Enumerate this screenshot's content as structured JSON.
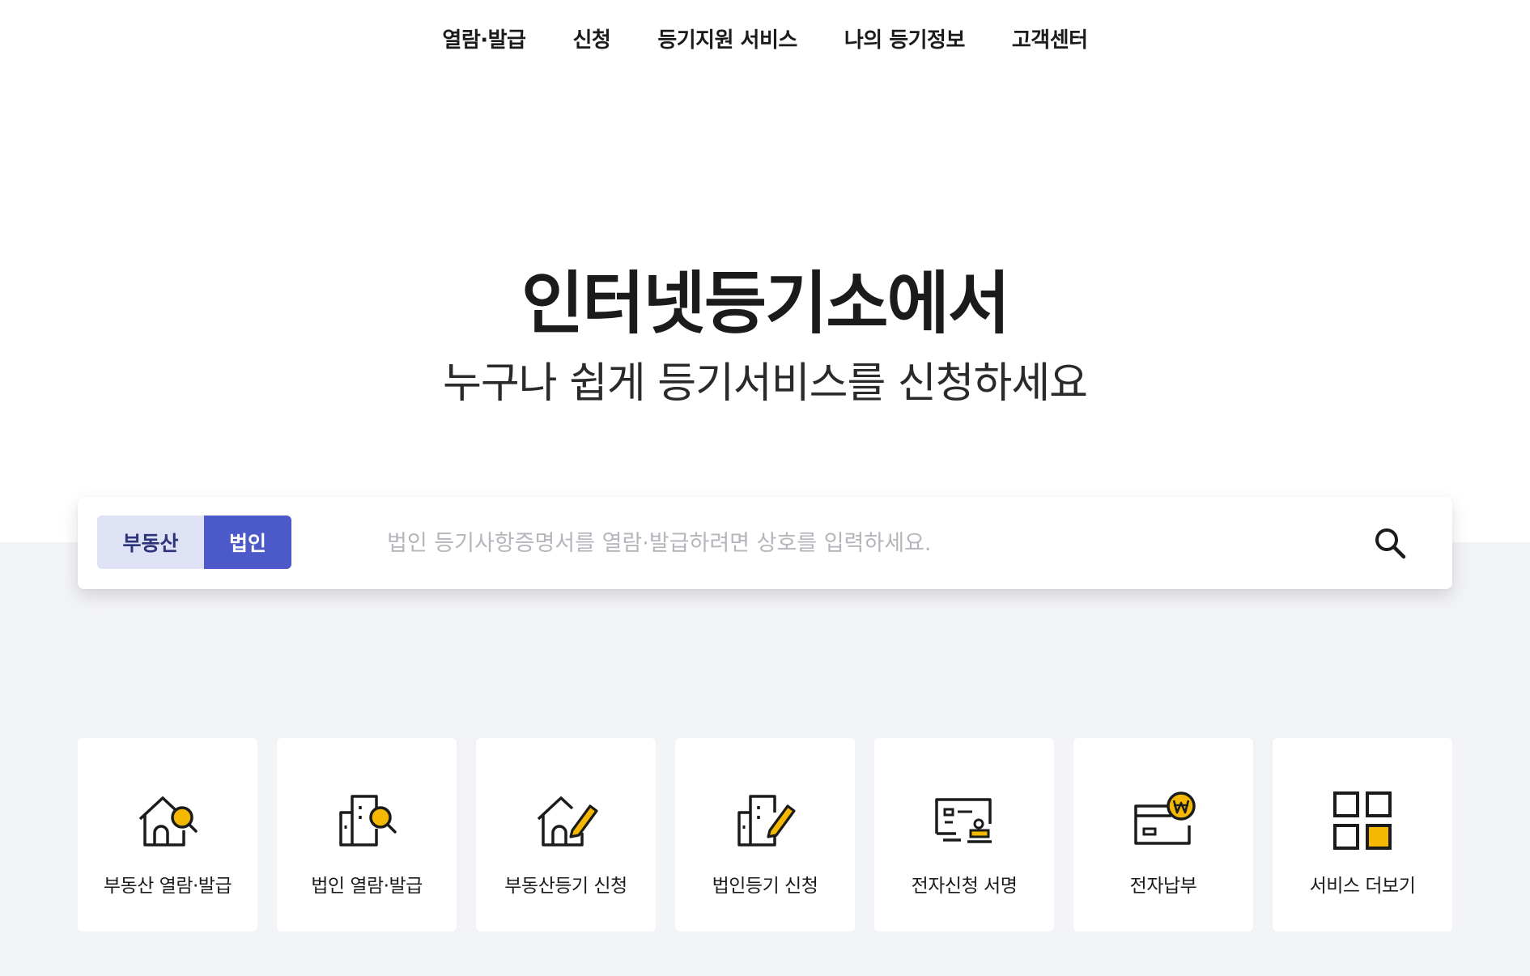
{
  "nav": {
    "items": [
      {
        "label": "열람·발급"
      },
      {
        "label": "신청"
      },
      {
        "label": "등기지원 서비스"
      },
      {
        "label": "나의 등기정보"
      },
      {
        "label": "고객센터"
      }
    ]
  },
  "hero": {
    "title": "인터넷등기소에서",
    "subtitle": "누구나 쉽게 등기서비스를 신청하세요"
  },
  "search": {
    "tabs": [
      {
        "label": "부동산",
        "selected": false
      },
      {
        "label": "법인",
        "selected": true
      }
    ],
    "value": "",
    "placeholder": "법인 등기사항증명서를 열람·발급하려면 상호를 입력하세요.",
    "button_icon": "search-icon"
  },
  "services": [
    {
      "label": "부동산 열람·발급",
      "icon": "house-search-icon"
    },
    {
      "label": "법인 열람·발급",
      "icon": "building-search-icon"
    },
    {
      "label": "부동산등기 신청",
      "icon": "house-pencil-icon"
    },
    {
      "label": "법인등기 신청",
      "icon": "building-pencil-icon"
    },
    {
      "label": "전자신청 서명",
      "icon": "document-stamp-icon"
    },
    {
      "label": "전자납부",
      "icon": "card-payment-icon"
    },
    {
      "label": "서비스 더보기",
      "icon": "grid-more-icon"
    }
  ],
  "colors": {
    "accent": "#4b5ac8",
    "accent_light": "#dfe1f4",
    "icon_highlight": "#f5b800",
    "background_band": "#f2f3f6"
  }
}
